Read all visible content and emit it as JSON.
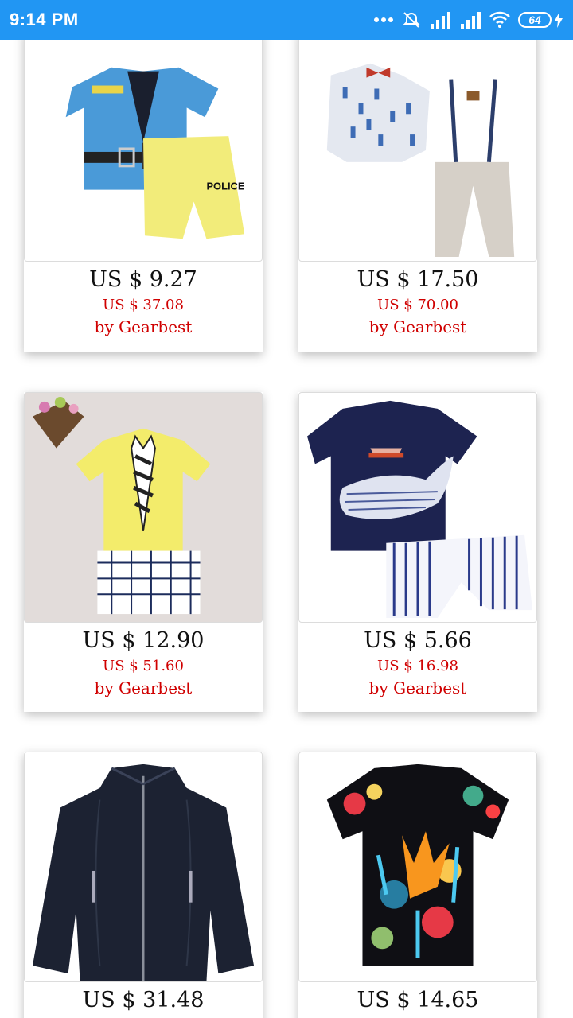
{
  "status_bar": {
    "time": "9:14 PM",
    "battery": "64",
    "icons": [
      "more-dots-icon",
      "alarm-off-icon",
      "signal-icon",
      "signal-icon",
      "wifi-icon",
      "battery-icon",
      "charging-icon"
    ]
  },
  "products": [
    {
      "price": "US $ 9.27",
      "old_price": "US $ 37.08",
      "seller": "by Gearbest",
      "image": "police-outfit"
    },
    {
      "price": "US $ 17.50",
      "old_price": "US $ 70.00",
      "seller": "by Gearbest",
      "image": "shirt-suspenders-set"
    },
    {
      "price": "US $ 12.90",
      "old_price": "US $ 51.60",
      "seller": "by Gearbest",
      "image": "yellow-tie-tshirt-set"
    },
    {
      "price": "US $ 5.66",
      "old_price": "US $ 16.98",
      "seller": "by Gearbest",
      "image": "whale-tshirt-set"
    },
    {
      "price": "US $ 31.48",
      "image": "leather-jacket"
    },
    {
      "price": "US $ 14.65",
      "image": "paint-splash-tshirt"
    }
  ],
  "colors": {
    "status_bar": "#2196f3",
    "sale_red": "#d00000"
  }
}
